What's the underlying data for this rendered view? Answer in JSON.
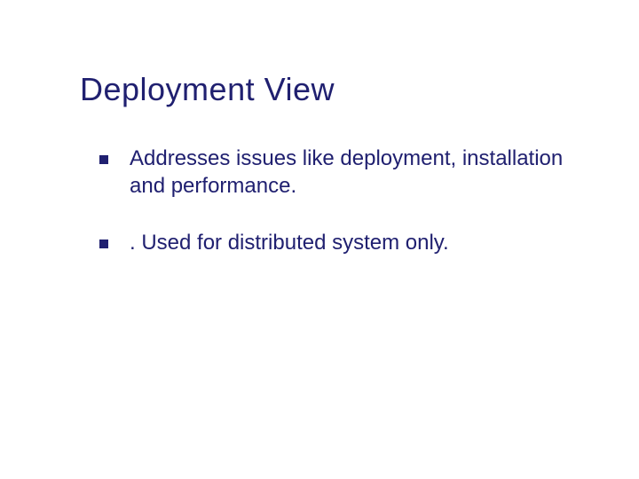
{
  "slide": {
    "title": "Deployment View",
    "bullets": [
      "Addresses issues like deployment, installation and performance.",
      ". Used for distributed system only."
    ]
  }
}
